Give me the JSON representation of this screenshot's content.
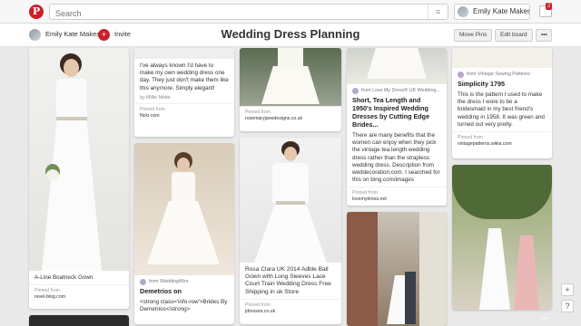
{
  "topbar": {
    "logo": "P",
    "search_placeholder": "Search",
    "search_menu_icon": "menu-lines-icon",
    "user_name": "Emily Kate Makes",
    "notification_count": "2"
  },
  "board": {
    "owner": "Emily Kate Makes",
    "invite_label": "Invite",
    "title": "Wedding Dress Planning",
    "move_pins": "Move Pins",
    "edit_board": "Edit board",
    "more": "•••"
  },
  "pins": {
    "p1": {
      "desc": "A-Line Boatneck Gown",
      "pinned_from": "Pinned from",
      "source": "revel-blog.com"
    },
    "p2": {
      "desc": "I've always known I'd have to make my own wedding dress one day. They just don't make them like this anymore. Simply elegant!",
      "by": "by Millie Motts",
      "pinned_from": "Pinned from",
      "source": "flickr.com"
    },
    "p3": {
      "via": "from WeddingWire",
      "title": "Demetrios on",
      "snippet": "<strong class='info-row'>Brides By Demetrios</strong>"
    },
    "p4": {
      "pinned_from": "Pinned from",
      "source": "rosemaryjanedesigns.co.uk"
    },
    "p5": {
      "desc": "Rosa Clara UK 2014 Adble Ball Gown with Long Sleeves Lace Court Train Wedding Dress Free Shipping in uk Store",
      "pinned_from": "Pinned from",
      "source": "jdresses.co.uk"
    },
    "p6": {
      "via": "from Love My Dress® UK Wedding...",
      "title": "Short, Tea Length and 1950's Inspired Wedding Dresses by Cutting Edge Brides...",
      "desc": "There are many benefits that the women can enjoy when they pick the vintage tea length wedding dress rather than the strapless wedding dress. Description from weddecoration.com. I searched for this on bing.com/images",
      "pinned_from": "Pinned from",
      "source": "lovemydress.net"
    },
    "p7": {
      "via": "from Vintage Sewing Patterns",
      "title": "Simplicity 1795",
      "desc": "This is the pattern I used to make the dress I wore to be a bridesmaid in my best friend's wedding in 1958. It was green and turned out very pretty.",
      "pinned_from": "Pinned from",
      "source": "vintagepatterns.wikia.com"
    }
  },
  "ui": {
    "scroll_top": "+",
    "expand": "?",
    "dots": "•••"
  }
}
